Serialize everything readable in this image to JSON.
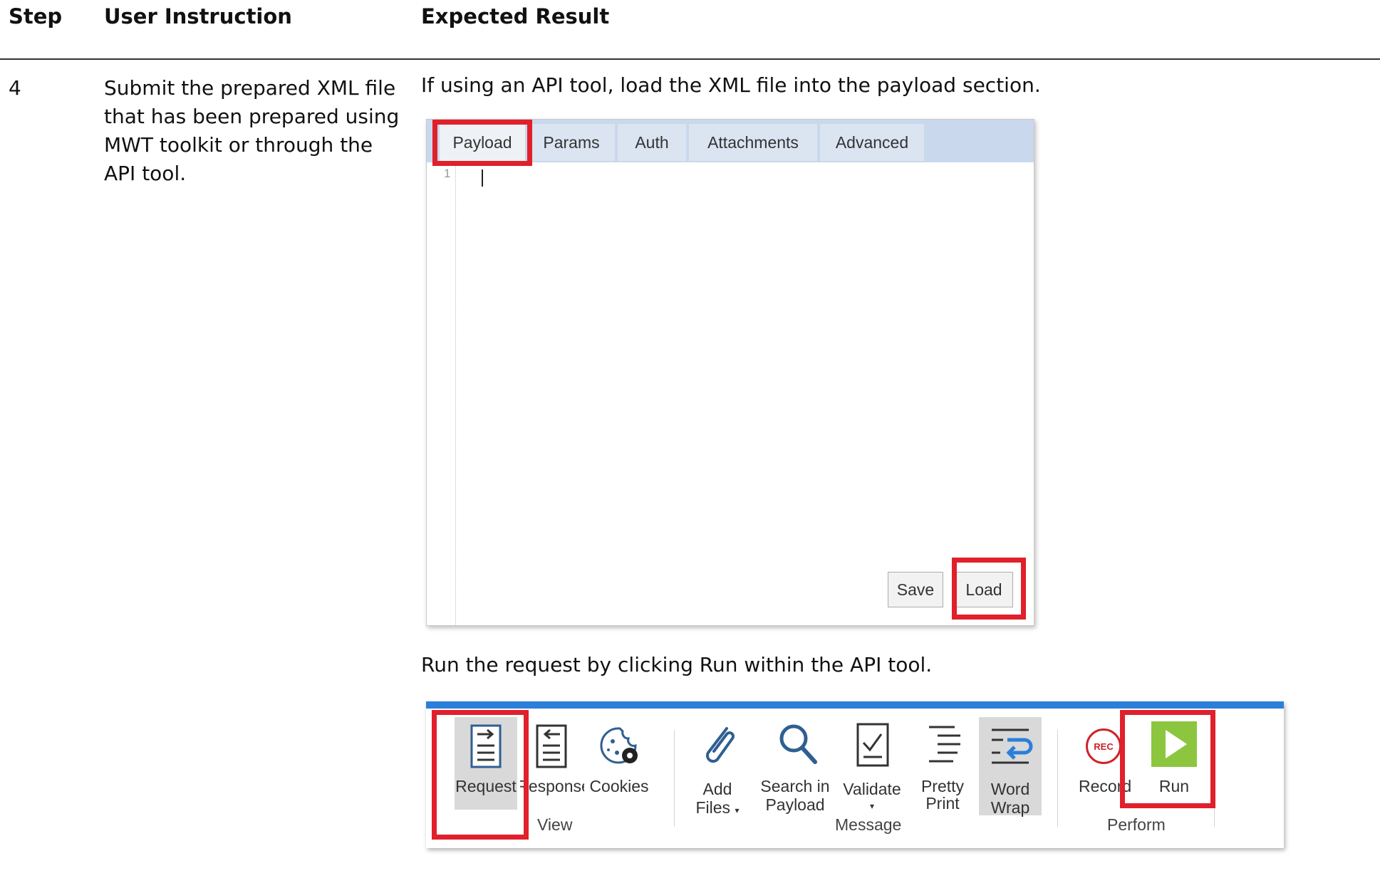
{
  "table": {
    "headers": {
      "step": "Step",
      "instruction": "User Instruction",
      "result": "Expected Result"
    },
    "row": {
      "step": "4",
      "instruction_lines": [
        "Submit the prepared XML file",
        "that has been prepared using",
        "MWT toolkit or through the",
        "API tool."
      ],
      "result_text_1": "If using an API tool, load the XML file into the payload section.",
      "result_text_2": "Run the request by clicking Run within the API tool."
    }
  },
  "editor": {
    "tabs": [
      "Payload",
      "Params",
      "Auth",
      "Attachments",
      "Advanced"
    ],
    "active_tab": "Payload",
    "line_number": "1",
    "save_label": "Save",
    "load_label": "Load"
  },
  "ribbon": {
    "buttons": {
      "request": "Request",
      "response": "Response",
      "cookies": "Cookies",
      "add_files_1": "Add",
      "add_files_2": "Files",
      "search_1": "Search in",
      "search_2": "Payload",
      "validate": "Validate",
      "pretty_1": "Pretty",
      "pretty_2": "Print",
      "wrap_1": "Word",
      "wrap_2": "Wrap",
      "record": "Record",
      "record_badge": "REC",
      "run": "Run"
    },
    "groups": {
      "view": "View",
      "message": "Message",
      "perform": "Perform"
    },
    "icons": [
      "request-icon",
      "response-icon",
      "cookies-icon",
      "paperclip-icon",
      "search-icon",
      "validate-icon",
      "pretty-print-icon",
      "word-wrap-icon",
      "record-icon",
      "run-play-icon"
    ],
    "colors": {
      "highlight_box": "#e0202a",
      "accent_bar": "#2b7fd8",
      "run_green": "#8cc63f"
    }
  }
}
